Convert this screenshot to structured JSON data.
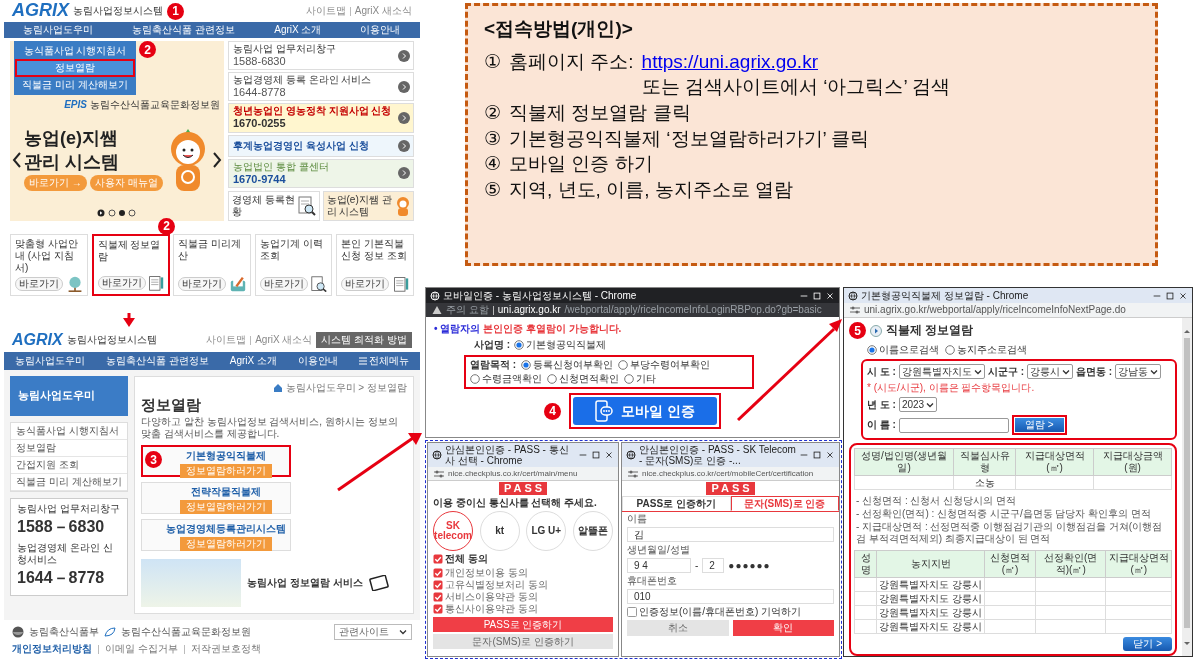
{
  "guide": {
    "title": "<접속방법(개인)>",
    "steps": [
      {
        "number": "①",
        "text": "홈페이지 주소:",
        "link": "https://uni.agrix.go.kr",
        "note": "또는 검색사이트에서 ‘아그릭스’ 검색"
      },
      {
        "number": "②",
        "text": "직불제 정보열람 클릭"
      },
      {
        "number": "③",
        "text": "기본형공익직불제 ‘정보열람하러가기’ 클릭"
      },
      {
        "number": "④",
        "text": "모바일 인증 하기"
      },
      {
        "number": "⑤",
        "text": "지역, 년도, 이름, 농지주소로 열람"
      }
    ]
  },
  "homepage": {
    "logo": "AGRIX",
    "logo_subtitle": "농림사업정보시스템",
    "marker": "1",
    "top_links": [
      "사이트맵",
      "AgriX 새소식"
    ],
    "nav": [
      "농림사업도우미",
      "농림축산식품 관련정보",
      "AgriX 소개",
      "이용안내"
    ],
    "dropdown": {
      "marker": "2",
      "items": [
        {
          "label": "농식품사업 시행지침서",
          "selected": false
        },
        {
          "label": "정보열람",
          "selected": true
        },
        {
          "label": "직불금 미리 계산해보기",
          "selected": false
        }
      ]
    },
    "banner": {
      "org_logo": "EPIS",
      "org": "농림수산식품교육문화정보원",
      "title": "농업(e)지쌤",
      "subtitle": "관리 시스템",
      "buttons": [
        "바로가기 →",
        "사용자 매뉴얼"
      ]
    },
    "side_links": [
      {
        "title": "농림사업 업무처리창구",
        "phone": "1588-6830",
        "kind": "plain"
      },
      {
        "title": "농업경영체 등록 온라인 서비스",
        "phone": "1644-8778",
        "kind": "plain"
      },
      {
        "title": "청년농업인 영농정착 지원사업 신청",
        "phone": "1670-0255",
        "kind": "youth"
      },
      {
        "title": "후계농업경영인 육성사업 신청",
        "kind": "successor"
      },
      {
        "title": "농업법인 통합 콜센터",
        "phone": "1670-9744",
        "kind": "corp"
      }
    ],
    "tiles": [
      "경영체 등록현황",
      "농업(e)지쌤 관리 시스템"
    ],
    "cards_marker": "2",
    "cards": [
      {
        "title": "맞춤형 사업안내 (사업 지침서)",
        "button": "바로가기",
        "selected": false
      },
      {
        "title": "직불제 정보열람",
        "button": "바로가기",
        "selected": true
      },
      {
        "title": "직불금 미리계산",
        "button": "바로가기",
        "selected": false
      },
      {
        "title": "농업기계 이력 조회",
        "button": "바로가기",
        "selected": false
      },
      {
        "title": "본인 기본직불 신청 정보 조회",
        "button": "바로가기",
        "selected": false
      }
    ]
  },
  "info_page": {
    "logo": "AGRIX",
    "logo_subtitle": "농림사업정보시스템",
    "top_links": [
      "사이트맵",
      "AgriX 새소식"
    ],
    "optimize_button": "시스템 최적화 방법",
    "nav": [
      "농림사업도우미",
      "농림축산식품 관련정보",
      "AgriX 소개",
      "이용안내",
      "전체메뉴"
    ],
    "side_title": "농림사업도우미",
    "side_menu": [
      "농식품사업 시행지침서",
      "정보열람",
      "간접지원 조회",
      "직불금 미리 계산해보기"
    ],
    "contacts": [
      {
        "title": "농림사업 업무처리창구",
        "phone": "1588－6830"
      },
      {
        "title": "농업경영체 온라인 신청서비스",
        "phone": "1644－8778"
      }
    ],
    "breadcrumb": "농림사업도우미 > 정보열람",
    "title": "정보열람",
    "description": "다양하고 알찬 농림사업정보 검색서비스, 원하시는 정보의 맞춤 검색서비스를 제공합니다.",
    "marker": "3",
    "services": [
      {
        "name": "기본형공익직불제",
        "button": "정보열람하러가기",
        "selected": true
      },
      {
        "name": "전략작물직불제",
        "button": "정보열람하러가기",
        "selected": false
      },
      {
        "name": "농업경영체등록관리시스템",
        "button": "정보열람하러가기",
        "selected": false
      }
    ],
    "promo": "농림사업 정보열람 서비스",
    "footer_orgs": [
      "농림축산식품부",
      "농림수산식품교육문화정보원"
    ],
    "footer_links": [
      "개인정보처리방침",
      "이메일 수집거부",
      "저작권보호정책"
    ],
    "related_select": "관련사이트"
  },
  "auth_popup": {
    "title": "모바일인증 - 농림사업정보시스템 - Chrome",
    "security": "주의 요함",
    "url_host": "uni.agrix.go.kr",
    "url_path": "/webportal/apply/riceIncomeInfoLoginRBPop.do?gb=basic",
    "notice": "• 열람자의 ",
    "notice_alert": "본인인증 후열람이 가능합니다.",
    "business_label": "사업명 :",
    "business": [
      {
        "label": "기본형공익직불제",
        "selected": true
      }
    ],
    "purpose_label": "열람목적 :",
    "purposes": [
      {
        "label": "등록신청여부확인",
        "selected": true
      },
      {
        "label": "부당수령여부확인",
        "selected": false
      },
      {
        "label": "수령금액확인",
        "selected": false
      },
      {
        "label": "신청면적확인",
        "selected": false
      },
      {
        "label": "기타",
        "selected": false
      }
    ],
    "marker": "4",
    "button": "모바일 인증"
  },
  "pass_carrier": {
    "title": "안심본인인증 - PASS - 통신사 선택 - Chrome",
    "url": "nice.checkplus.co.kr/cert/main/menu",
    "logo": "PASS",
    "prompt": "이용 중이신 통신사를 선택해 주세요.",
    "carriers": [
      {
        "label": "SK telecom",
        "selected": true
      },
      {
        "label": "kt",
        "selected": false
      },
      {
        "label": "LG U+",
        "selected": false
      },
      {
        "label": "알뜰폰",
        "selected": false
      }
    ],
    "agree_all": {
      "label": "전체 동의",
      "checked": true
    },
    "agreements": [
      {
        "label": "개인정보이용 동의",
        "checked": true
      },
      {
        "label": "고유식별정보처리 동의",
        "checked": true
      },
      {
        "label": "서비스이용약관 동의",
        "checked": true
      },
      {
        "label": "통신사이용약관 동의",
        "checked": true
      }
    ],
    "buttons": [
      {
        "label": "PASS로 인증하기",
        "kind": "primary"
      },
      {
        "label": "문자(SMS)로 인증하기",
        "kind": "secondary"
      }
    ]
  },
  "pass_sms": {
    "title": "안심본인인증 - PASS - SK Telecom - 문자(SMS)로 인증 -...",
    "url": "nice.checkplus.co.kr/cert/mobileCert/certification",
    "logo": "PASS",
    "tabs": [
      {
        "label": "PASS로 인증하기",
        "selected": false
      },
      {
        "label": "문자(SMS)로 인증",
        "selected": true
      }
    ],
    "name_label": "이름",
    "name": "김",
    "birth_label": "생년월일/성별",
    "birth": "9 4",
    "separator": "-",
    "gender": "2",
    "masked": "●●●●●●",
    "phone_label": "휴대폰번호",
    "phone": "010",
    "remember": {
      "label": "인증정보(이름/휴대폰번호) 기억하기",
      "checked": false
    },
    "buttons": [
      {
        "label": "취소",
        "kind": "secondary"
      },
      {
        "label": "확인",
        "kind": "primary"
      }
    ]
  },
  "result_popup": {
    "title": "기본형공익직불제 정보열람 - Chrome",
    "url": "uni.agrix.go.kr/webportal/apply/riceIncomeInfoNextPage.do",
    "marker": "5",
    "heading": "직불제 정보열람",
    "search_modes": [
      {
        "label": "이름으로검색",
        "selected": true
      },
      {
        "label": "농지주소로검색",
        "selected": false
      }
    ],
    "sido_label": "시 도 :",
    "sido": "강원특별자치도",
    "sigungu_label": "시군구 :",
    "sigungu": "강릉시",
    "eup_label": "읍면동 :",
    "eup": "강남동",
    "required_note": "* (시도/시군), 이름은 필수항목입니다.",
    "year_label": "년 도 :",
    "year": "2023",
    "name_label": "이 름 :",
    "search_button": "열람 >",
    "summary_columns": [
      "성명/법인명(생년월일)",
      "직불심사유형",
      "지급대상면적(㎡)",
      "지급대상금액(원)"
    ],
    "summary_rows": [
      {
        "type": "소농"
      }
    ],
    "notes": [
      "- 신청면적 : 신청서 신청당시의 면적",
      "- 선정확인(면적) : 신청면적중 시군구/읍면동 담당자 확인후의 면적",
      "- 지급대상면적 : 선정면적중 이행점검기관의 이행점검을 거쳐(이행점검 부적격면적제외) 최종지급대상이 된 면적"
    ],
    "detail_columns": [
      "성명",
      "농지지번",
      "신청면적(㎡)",
      "선정확인(면적)(㎡)",
      "지급대상면적(㎡)"
    ],
    "detail_rows": [
      {
        "address": "강원특별자치도 강릉시"
      },
      {
        "address": "강원특별자치도 강릉시"
      },
      {
        "address": "강원특별자치도 강릉시"
      },
      {
        "address": "강원특별자치도 강릉시"
      }
    ],
    "close_button": "닫기 >"
  }
}
